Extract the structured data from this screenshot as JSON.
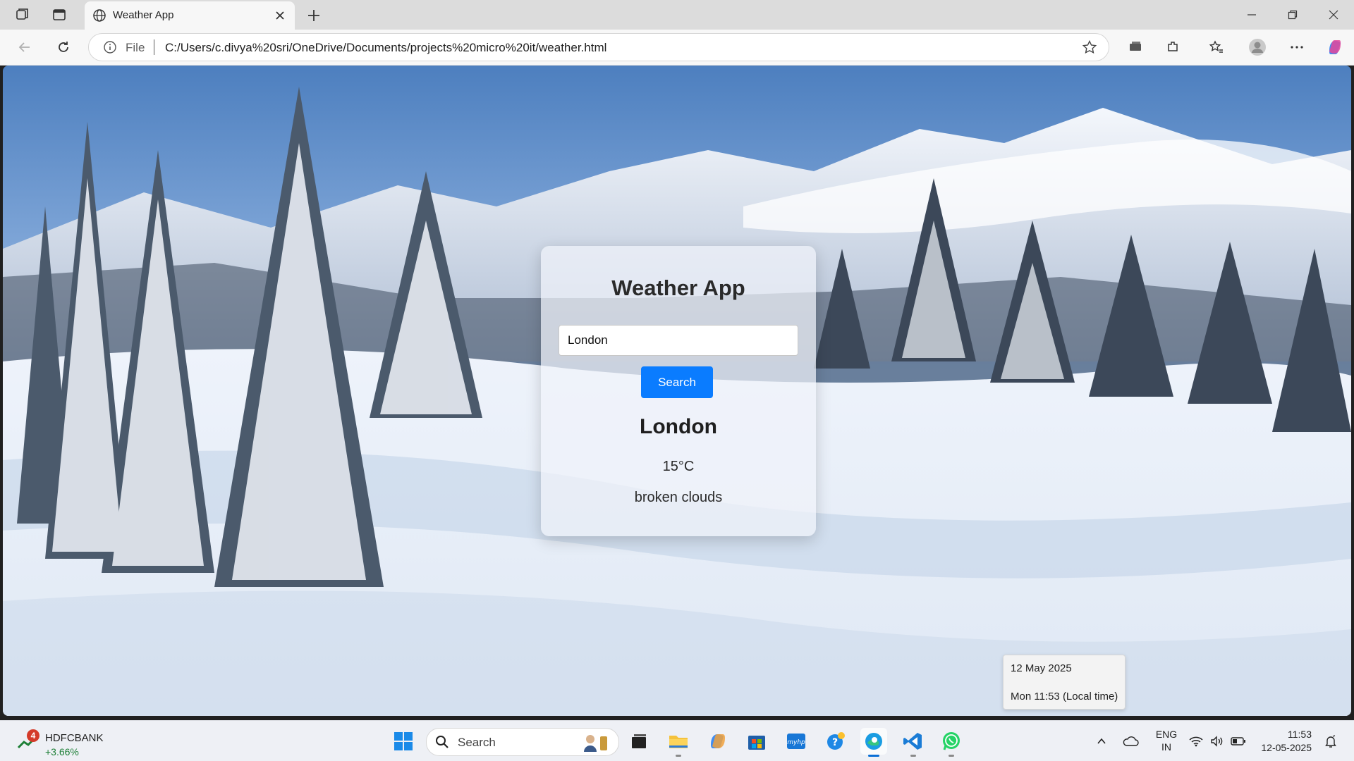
{
  "browser": {
    "tab_title": "Weather App",
    "address": {
      "scheme": "File",
      "url": "C:/Users/c.divya%20sri/OneDrive/Documents/projects%20micro%20it/weather.html"
    }
  },
  "app": {
    "title": "Weather App",
    "search_input_value": "London",
    "search_button_label": "Search",
    "result": {
      "city": "London",
      "temperature": "15°C",
      "description": "broken clouds"
    }
  },
  "date_popup": {
    "date": "12 May 2025",
    "local_time": "Mon 11:53 (Local time)"
  },
  "taskbar": {
    "stock": {
      "badge": "4",
      "name": "HDFCBANK",
      "change": "+3.66%"
    },
    "search_label": "Search",
    "language": {
      "line1": "ENG",
      "line2": "IN"
    },
    "clock": {
      "time": "11:53",
      "date": "12-05-2025"
    },
    "apps": [
      "file-explorer",
      "copilot",
      "microsoft-store",
      "myhp",
      "help",
      "edge",
      "vscode",
      "whatsapp"
    ]
  },
  "colors": {
    "accent": "#0a7cff",
    "card_bg": "#f0f2fa",
    "stock_positive": "#1d7f36"
  }
}
